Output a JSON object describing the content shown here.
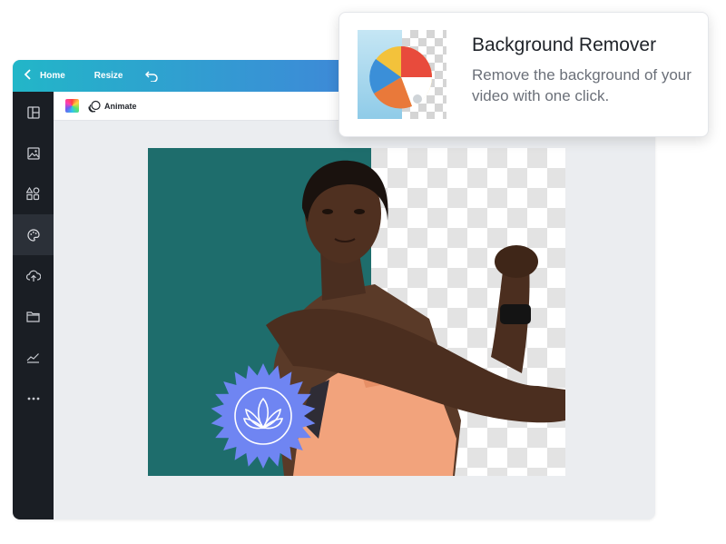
{
  "popup": {
    "title": "Background Remover",
    "description": "Remove the background of your video with one click.",
    "thumbnail_icon": "beach-ball-icon"
  },
  "topbar": {
    "back_icon": "chevron-left-icon",
    "home_label": "Home",
    "resize_label": "Resize",
    "undo_icon": "undo-icon",
    "gradient_start": "#22b6c8",
    "gradient_end": "#5b60e0"
  },
  "toolbar": {
    "color_icon": "color-palette-swatch-icon",
    "animate_icon": "animate-icon",
    "animate_label": "Animate"
  },
  "sidebar": {
    "items": [
      {
        "icon": "templates-icon",
        "active": false
      },
      {
        "icon": "photos-icon",
        "active": false
      },
      {
        "icon": "elements-icon",
        "active": false
      },
      {
        "icon": "styles-palette-icon",
        "active": true
      },
      {
        "icon": "uploads-icon",
        "active": false
      },
      {
        "icon": "folder-icon",
        "active": false
      },
      {
        "icon": "charts-icon",
        "active": false
      },
      {
        "icon": "more-icon",
        "active": false
      }
    ]
  },
  "canvas": {
    "background_color": "#1e6d6c",
    "badge_color": "#6f85f2",
    "badge_icon": "lotus-icon"
  }
}
